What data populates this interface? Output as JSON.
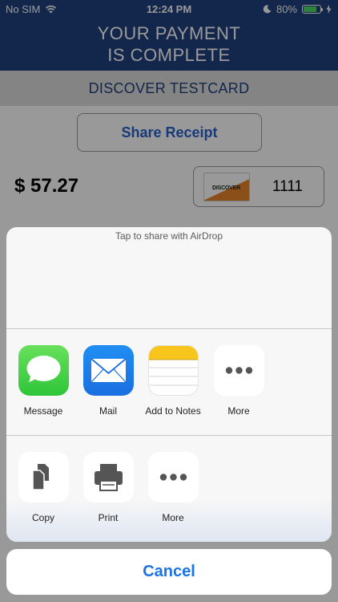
{
  "status_bar": {
    "carrier": "No SIM",
    "time": "12:24 PM",
    "battery": "80%",
    "battery_level": 0.8,
    "icons": [
      "wifi-icon",
      "moon-icon",
      "battery-icon",
      "charging-bolt-icon"
    ]
  },
  "header": {
    "title_line1": "YOUR PAYMENT",
    "title_line2": "IS COMPLETE"
  },
  "card": {
    "name": "DISCOVER TESTCARD",
    "brand_logo_text": "DISCOVER",
    "last4": "1111"
  },
  "receipt": {
    "share_label": "Share Receipt",
    "amount": "$ 57.27"
  },
  "share_sheet": {
    "airdrop_hint": "Tap to share with AirDrop",
    "apps": [
      {
        "label": "Message",
        "icon": "message-icon"
      },
      {
        "label": "Mail",
        "icon": "mail-icon"
      },
      {
        "label": "Add to Notes",
        "icon": "notes-icon"
      },
      {
        "label": "More",
        "icon": "more-icon"
      }
    ],
    "actions": [
      {
        "label": "Copy",
        "icon": "copy-icon"
      },
      {
        "label": "Print",
        "icon": "print-icon"
      },
      {
        "label": "More",
        "icon": "more-icon"
      }
    ],
    "cancel_label": "Cancel"
  },
  "colors": {
    "brand_blue": "#21407f",
    "link_blue": "#1a73e8",
    "message_green": "#2ec53a",
    "mail_blue": "#1a6fe0",
    "notes_yellow": "#f8c51c"
  }
}
